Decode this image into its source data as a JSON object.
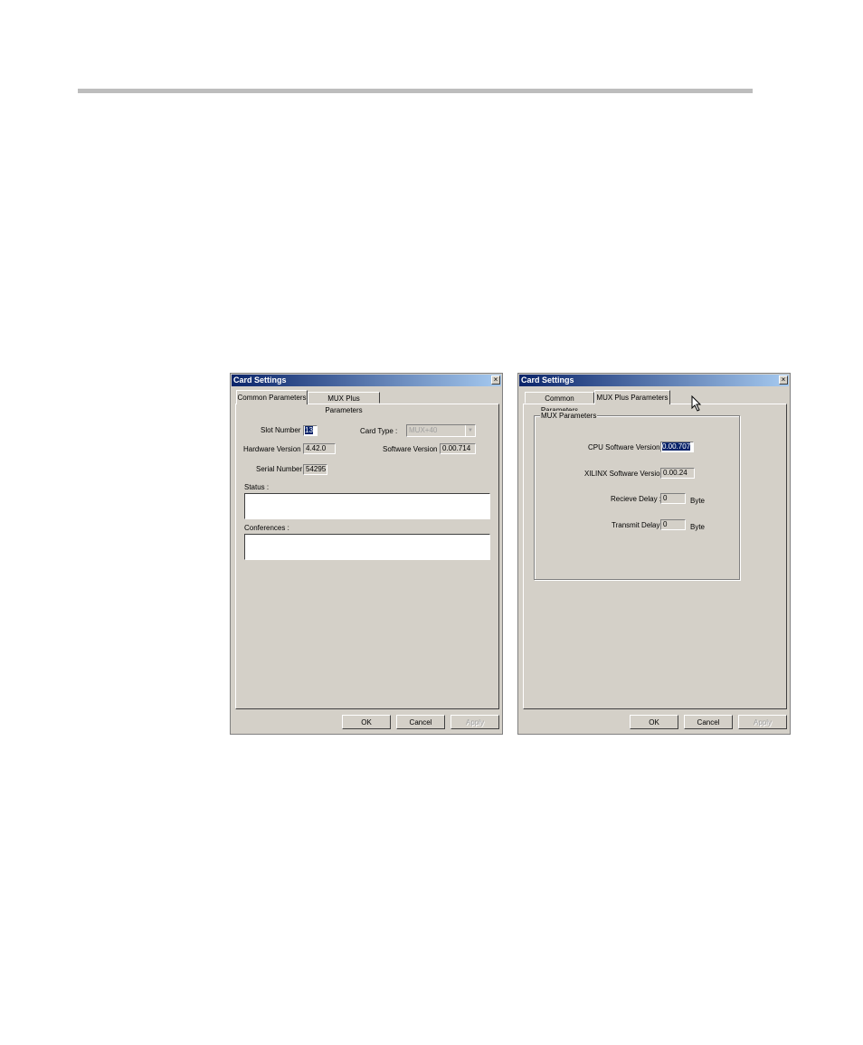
{
  "dialog_left": {
    "title": "Card Settings",
    "close": "×",
    "tabs": [
      "Common Parameters",
      "MUX Plus Parameters"
    ],
    "active_tab": "Common Parameters",
    "slot_number_label": "Slot Number :",
    "slot_number_value": "13",
    "card_type_label": "Card Type :",
    "card_type_value": "MUX+40",
    "hardware_version_label": "Hardware Version :",
    "hardware_version_value": "4.42.0",
    "software_version_label": "Software Version :",
    "software_version_value": "0.00.714",
    "serial_number_label": "Serial Number :",
    "serial_number_value": "54295",
    "status_label": "Status :",
    "conferences_label": "Conferences :",
    "buttons": {
      "ok": "OK",
      "cancel": "Cancel",
      "apply": "Apply"
    }
  },
  "dialog_right": {
    "title": "Card Settings",
    "close": "×",
    "tabs": [
      "Common Parameters",
      "MUX Plus Parameters"
    ],
    "active_tab": "MUX Plus Parameters",
    "group_title": "MUX Parameters",
    "cpu_software_version_label": "CPU Software Version :",
    "cpu_software_version_value": "0.00.707",
    "xilinx_software_version_label": "XILINX Software Version",
    "xilinx_software_version_value": "0.00.24",
    "receive_delay_label": "Recieve Delay :",
    "receive_delay_value": "0",
    "receive_delay_unit": "Byte",
    "transmit_delay_label": "Transmit Delay :",
    "transmit_delay_value": "0",
    "transmit_delay_unit": "Byte",
    "buttons": {
      "ok": "OK",
      "cancel": "Cancel",
      "apply": "Apply"
    }
  },
  "colors": {
    "titlebar_start": "#0a246a",
    "titlebar_end": "#a6caf0",
    "dialog_face": "#d4d0c8",
    "page_rule": "#bdbdbd"
  }
}
